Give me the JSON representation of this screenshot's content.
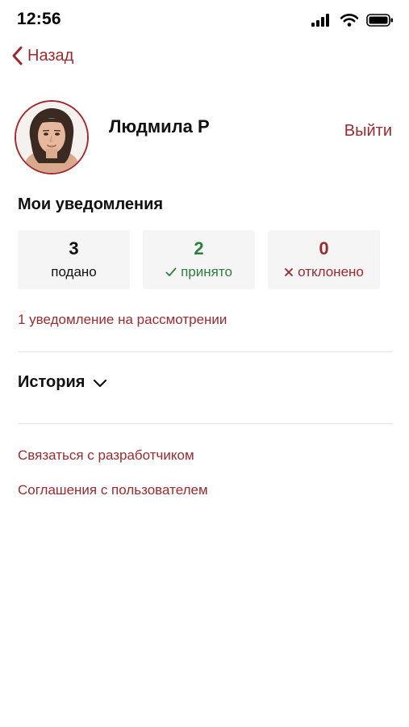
{
  "status_bar": {
    "time": "12:56",
    "icons": [
      "signal-icon",
      "wifi-icon",
      "battery-icon"
    ]
  },
  "nav": {
    "back_label": "Назад"
  },
  "profile": {
    "name": "Людмила Р",
    "logout_label": "Выйти"
  },
  "notifications": {
    "title": "Мои уведомления",
    "stats": [
      {
        "value": "3",
        "label": "подано",
        "icon": ""
      },
      {
        "value": "2",
        "label": "принято",
        "icon": "check-icon"
      },
      {
        "value": "0",
        "label": "отклонено",
        "icon": "cross-icon"
      }
    ],
    "pending_text": "1 уведомление на рассмотрении"
  },
  "history": {
    "label": "История",
    "icon": "chevron-down-icon"
  },
  "links": {
    "contact_developer": "Связаться с разработчиком",
    "user_agreements": "Соглашения с пользователем"
  },
  "colors": {
    "accent": "#9b2a2f",
    "success": "#2f7d3f",
    "card_bg": "#f5f5f5",
    "divider": "#e3e3e3"
  }
}
